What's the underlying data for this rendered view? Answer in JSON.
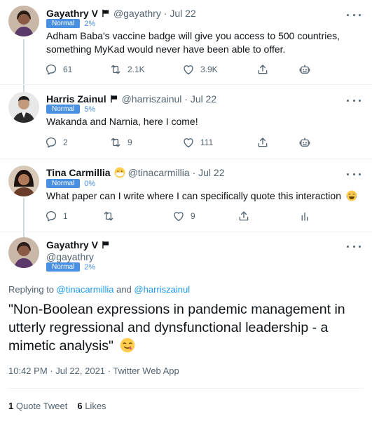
{
  "tweets": [
    {
      "name": "Gayathry V",
      "handle": "@gayathry",
      "date": "Jul 22",
      "badge": "Normal",
      "pct": "2%",
      "text_lines": [
        "Adham Baba's vaccine badge will give you access to 500 countries,",
        "something MyKad would never have been able to offer."
      ],
      "reply_count": "61",
      "retweet_count": "2.1K",
      "like_count": "3.9K"
    },
    {
      "name": "Harris Zainul",
      "handle": "@harriszainul",
      "date": "Jul 22",
      "badge": "Normal",
      "pct": "5%",
      "text_lines": [
        "Wakanda and Narnia, here I come!"
      ],
      "reply_count": "2",
      "retweet_count": "9",
      "like_count": "111"
    },
    {
      "name": "Tina Carmillia",
      "handle": "@tinacarmillia",
      "date": "Jul 22",
      "badge": "Normal",
      "pct": "0%",
      "text_lines": [
        "What paper can I write where I can specifically quote this interaction"
      ],
      "reply_count": "1",
      "retweet_count": "",
      "like_count": "9"
    }
  ],
  "main": {
    "name": "Gayathry V",
    "handle": "@gayathry",
    "badge": "Normal",
    "pct": "2%",
    "replying_prefix": "Replying to ",
    "reply_user1": "@tinacarmillia",
    "reply_and": " and ",
    "reply_user2": "@harriszainul",
    "text": "\"Non-Boolean expressions in pandemic management in utterly regressional and dynsfunctional leadership - a mimetic analysis\"",
    "timestamp": "10:42 PM · Jul 22, 2021 · Twitter Web App",
    "quote_count": "1",
    "quote_label": "Quote Tweet",
    "like_count": "6",
    "like_label": "Likes"
  },
  "separator_dot": "·",
  "colors": {
    "accent": "#1d9bf0",
    "badge": "#4a90e2",
    "muted": "#536471"
  }
}
